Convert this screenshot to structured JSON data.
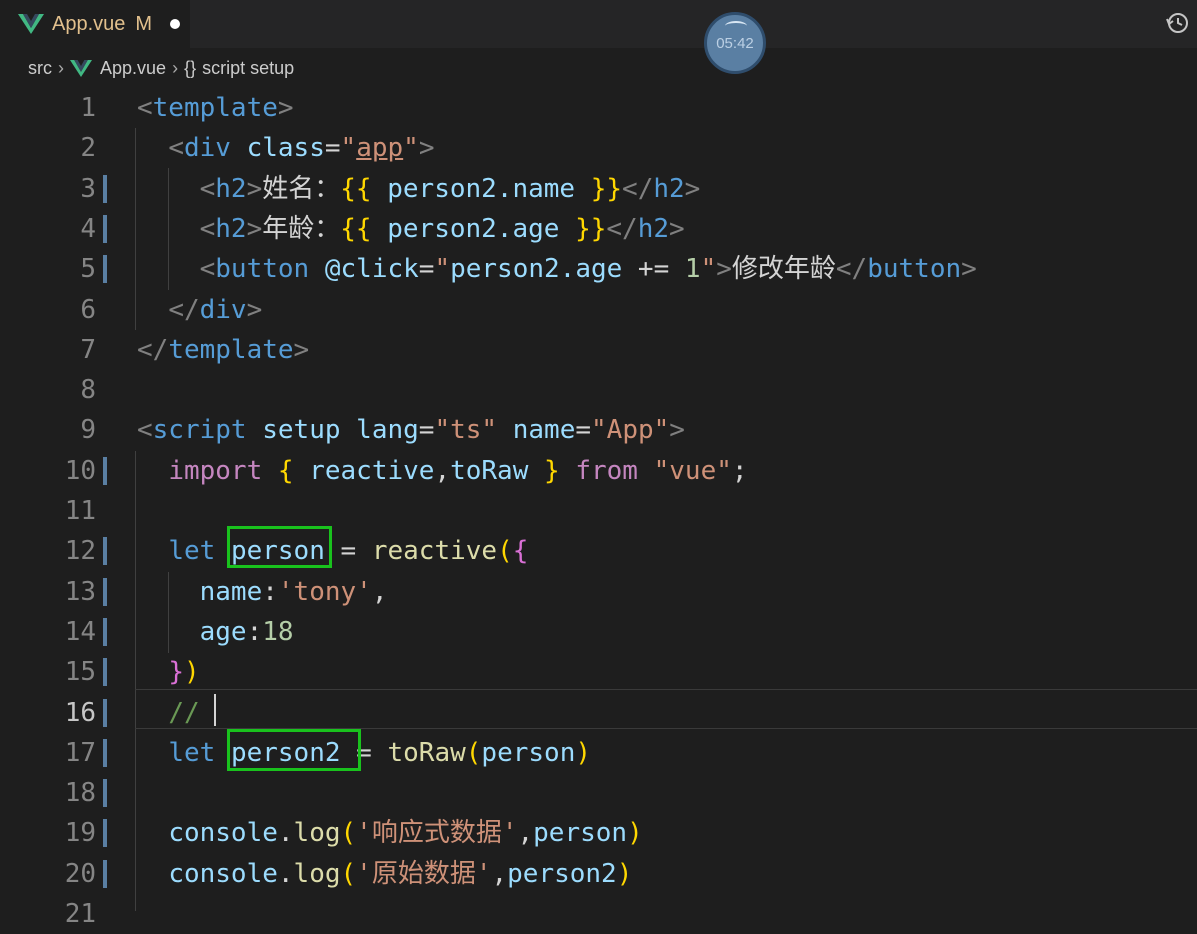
{
  "tab": {
    "title": "App.vue",
    "modified": "M",
    "icon": "vue-logo-icon"
  },
  "timer": {
    "time": "05:42"
  },
  "breadcrumb": {
    "src": "src",
    "file": "App.vue",
    "braces": "{}",
    "symbol": "script setup"
  },
  "editor": {
    "cursor_line": 16,
    "lines": [
      {
        "n": "1",
        "tokens": [
          [
            "t-tag",
            "<"
          ],
          [
            "t-tagname",
            "template"
          ],
          [
            "t-tag",
            ">"
          ]
        ]
      },
      {
        "n": "2",
        "tokens": [
          [
            "t-ink",
            "  "
          ],
          [
            "t-tag",
            "<"
          ],
          [
            "t-tagname",
            "div"
          ],
          [
            "t-ink",
            " "
          ],
          [
            "t-attr",
            "class"
          ],
          [
            "t-ink",
            "="
          ],
          [
            "t-str",
            "\""
          ],
          [
            "t-str t-underline",
            "app"
          ],
          [
            "t-str",
            "\""
          ],
          [
            "t-tag",
            ">"
          ]
        ]
      },
      {
        "n": "3",
        "tokens": [
          [
            "t-ink",
            "    "
          ],
          [
            "t-tag",
            "<"
          ],
          [
            "t-tagname",
            "h2"
          ],
          [
            "t-tag",
            ">"
          ],
          [
            "t-ink",
            "姓名："
          ],
          [
            "t-brace",
            "{{"
          ],
          [
            "t-ink",
            " "
          ],
          [
            "t-var",
            "person2.name"
          ],
          [
            "t-ink",
            " "
          ],
          [
            "t-brace",
            "}}"
          ],
          [
            "t-tag",
            "</"
          ],
          [
            "t-tagname",
            "h2"
          ],
          [
            "t-tag",
            ">"
          ]
        ]
      },
      {
        "n": "4",
        "tokens": [
          [
            "t-ink",
            "    "
          ],
          [
            "t-tag",
            "<"
          ],
          [
            "t-tagname",
            "h2"
          ],
          [
            "t-tag",
            ">"
          ],
          [
            "t-ink",
            "年龄："
          ],
          [
            "t-brace",
            "{{"
          ],
          [
            "t-ink",
            " "
          ],
          [
            "t-var",
            "person2.age"
          ],
          [
            "t-ink",
            " "
          ],
          [
            "t-brace",
            "}}"
          ],
          [
            "t-tag",
            "</"
          ],
          [
            "t-tagname",
            "h2"
          ],
          [
            "t-tag",
            ">"
          ]
        ]
      },
      {
        "n": "5",
        "tokens": [
          [
            "t-ink",
            "    "
          ],
          [
            "t-tag",
            "<"
          ],
          [
            "t-tagname",
            "button"
          ],
          [
            "t-ink",
            " "
          ],
          [
            "t-attr",
            "@click"
          ],
          [
            "t-ink",
            "="
          ],
          [
            "t-str",
            "\""
          ],
          [
            "t-var",
            "person2.age"
          ],
          [
            "t-ink",
            " += "
          ],
          [
            "t-num",
            "1"
          ],
          [
            "t-str",
            "\""
          ],
          [
            "t-tag",
            ">"
          ],
          [
            "t-ink",
            "修改年龄"
          ],
          [
            "t-tag",
            "</"
          ],
          [
            "t-tagname",
            "button"
          ],
          [
            "t-tag",
            ">"
          ]
        ]
      },
      {
        "n": "6",
        "tokens": [
          [
            "t-ink",
            "  "
          ],
          [
            "t-tag",
            "</"
          ],
          [
            "t-tagname",
            "div"
          ],
          [
            "t-tag",
            ">"
          ]
        ]
      },
      {
        "n": "7",
        "tokens": [
          [
            "t-tag",
            "</"
          ],
          [
            "t-tagname",
            "template"
          ],
          [
            "t-tag",
            ">"
          ]
        ]
      },
      {
        "n": "8",
        "tokens": []
      },
      {
        "n": "9",
        "tokens": [
          [
            "t-tag",
            "<"
          ],
          [
            "t-tagname",
            "script"
          ],
          [
            "t-ink",
            " "
          ],
          [
            "t-attr",
            "setup"
          ],
          [
            "t-ink",
            " "
          ],
          [
            "t-attr",
            "lang"
          ],
          [
            "t-ink",
            "="
          ],
          [
            "t-str",
            "\"ts\""
          ],
          [
            "t-ink",
            " "
          ],
          [
            "t-attr",
            "name"
          ],
          [
            "t-ink",
            "="
          ],
          [
            "t-str",
            "\"App\""
          ],
          [
            "t-tag",
            ">"
          ]
        ]
      },
      {
        "n": "10",
        "tokens": [
          [
            "t-ink",
            "  "
          ],
          [
            "t-import",
            "import"
          ],
          [
            "t-ink",
            " "
          ],
          [
            "t-brace",
            "{"
          ],
          [
            "t-ink",
            " "
          ],
          [
            "t-var",
            "reactive"
          ],
          [
            "t-ink",
            ","
          ],
          [
            "t-var",
            "toRaw"
          ],
          [
            "t-ink",
            " "
          ],
          [
            "t-brace",
            "}"
          ],
          [
            "t-ink",
            " "
          ],
          [
            "t-import",
            "from"
          ],
          [
            "t-ink",
            " "
          ],
          [
            "t-str",
            "\"vue\""
          ],
          [
            "t-ink",
            ";"
          ]
        ]
      },
      {
        "n": "11",
        "tokens": []
      },
      {
        "n": "12",
        "tokens": [
          [
            "t-ink",
            "  "
          ],
          [
            "t-kw",
            "let"
          ],
          [
            "t-ink",
            " "
          ],
          [
            "t-var",
            "person"
          ],
          [
            "t-ink",
            " = "
          ],
          [
            "t-func",
            "reactive"
          ],
          [
            "t-brace",
            "("
          ],
          [
            "t-paren2",
            "{"
          ]
        ]
      },
      {
        "n": "13",
        "tokens": [
          [
            "t-ink",
            "    "
          ],
          [
            "t-var",
            "name"
          ],
          [
            "t-ink",
            ":"
          ],
          [
            "t-str",
            "'tony'"
          ],
          [
            "t-ink",
            ","
          ]
        ]
      },
      {
        "n": "14",
        "tokens": [
          [
            "t-ink",
            "    "
          ],
          [
            "t-var",
            "age"
          ],
          [
            "t-ink",
            ":"
          ],
          [
            "t-num",
            "18"
          ]
        ]
      },
      {
        "n": "15",
        "tokens": [
          [
            "t-ink",
            "  "
          ],
          [
            "t-paren2",
            "}"
          ],
          [
            "t-brace",
            ")"
          ]
        ]
      },
      {
        "n": "16",
        "tokens": [
          [
            "t-ink",
            "  "
          ],
          [
            "t-comment",
            "// "
          ]
        ]
      },
      {
        "n": "17",
        "tokens": [
          [
            "t-ink",
            "  "
          ],
          [
            "t-kw",
            "let"
          ],
          [
            "t-ink",
            " "
          ],
          [
            "t-var",
            "person2"
          ],
          [
            "t-ink",
            " = "
          ],
          [
            "t-func",
            "toRaw"
          ],
          [
            "t-brace",
            "("
          ],
          [
            "t-var",
            "person"
          ],
          [
            "t-brace",
            ")"
          ]
        ]
      },
      {
        "n": "18",
        "tokens": []
      },
      {
        "n": "19",
        "tokens": [
          [
            "t-ink",
            "  "
          ],
          [
            "t-var",
            "console"
          ],
          [
            "t-ink",
            "."
          ],
          [
            "t-func",
            "log"
          ],
          [
            "t-brace",
            "("
          ],
          [
            "t-str",
            "'响应式数据'"
          ],
          [
            "t-ink",
            ","
          ],
          [
            "t-var",
            "person"
          ],
          [
            "t-brace",
            ")"
          ]
        ]
      },
      {
        "n": "20",
        "tokens": [
          [
            "t-ink",
            "  "
          ],
          [
            "t-var",
            "console"
          ],
          [
            "t-ink",
            "."
          ],
          [
            "t-func",
            "log"
          ],
          [
            "t-brace",
            "("
          ],
          [
            "t-str",
            "'原始数据'"
          ],
          [
            "t-ink",
            ","
          ],
          [
            "t-var",
            "person2"
          ],
          [
            "t-brace",
            ")"
          ]
        ]
      },
      {
        "n": "21",
        "tokens": []
      }
    ]
  },
  "colors": {
    "highlight_box": "#19c21d",
    "modified": "#e2c08d",
    "git_change": "#5a7fa3"
  }
}
